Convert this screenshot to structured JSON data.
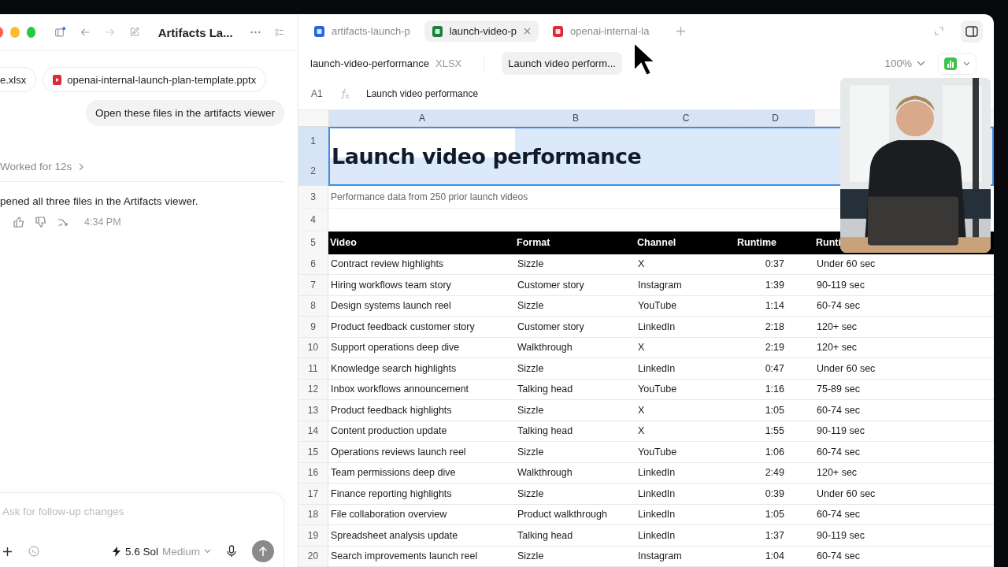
{
  "app_window": {
    "title": "Artifacts La..."
  },
  "chat": {
    "attachments": [
      {
        "name": "e.xlsx"
      },
      {
        "name": "openai-internal-launch-plan-template.pptx",
        "kind": "pptx"
      }
    ],
    "user_message": "Open these files in the artifacts viewer",
    "worked": "Worked for 12s",
    "reply": "pened all three files in the Artifacts viewer.",
    "time": "4:34 PM",
    "composer": {
      "placeholder": "Ask for follow-up changes",
      "model": "5.6 Sol",
      "effort": "Medium"
    }
  },
  "viewer": {
    "tabs": [
      {
        "label": "artifacts-launch-p",
        "kind": "doc",
        "selected": false
      },
      {
        "label": "launch-video-p",
        "kind": "sheet",
        "selected": true
      },
      {
        "label": "openai-internal-la",
        "kind": "slides",
        "selected": false
      }
    ],
    "file_name": "launch-video-performance",
    "file_type": "XLSX",
    "sheet_chip": "Launch video perform...",
    "zoom": "100%"
  },
  "spreadsheet": {
    "cell_ref": "A1",
    "formula": "Launch video performance",
    "columns": [
      "A",
      "B",
      "C",
      "D"
    ],
    "title_rows": [
      "1",
      "2"
    ],
    "title": "Launch video performance",
    "title_selected": true,
    "subtitle_row": "3",
    "subtitle": "Performance data from 250 prior launch videos",
    "blank_row": "4",
    "header_row": "5",
    "headers": [
      "Video",
      "Format",
      "Channel",
      "Runtime",
      "Runti"
    ],
    "rows": [
      {
        "n": "6",
        "cells": [
          "Contract review highlights",
          "Sizzle",
          "X",
          "0:37",
          "Under 60 sec"
        ]
      },
      {
        "n": "7",
        "cells": [
          "Hiring workflows team story",
          "Customer story",
          "Instagram",
          "1:39",
          "90-119 sec"
        ]
      },
      {
        "n": "8",
        "cells": [
          "Design systems launch reel",
          "Sizzle",
          "YouTube",
          "1:14",
          "60-74 sec"
        ]
      },
      {
        "n": "9",
        "cells": [
          "Product feedback customer story",
          "Customer story",
          "LinkedIn",
          "2:18",
          "120+ sec"
        ]
      },
      {
        "n": "10",
        "cells": [
          "Support operations deep dive",
          "Walkthrough",
          "X",
          "2:19",
          "120+ sec"
        ]
      },
      {
        "n": "11",
        "cells": [
          "Knowledge search highlights",
          "Sizzle",
          "LinkedIn",
          "0:47",
          "Under 60 sec"
        ]
      },
      {
        "n": "12",
        "cells": [
          "Inbox workflows announcement",
          "Talking head",
          "YouTube",
          "1:16",
          "75-89 sec"
        ]
      },
      {
        "n": "13",
        "cells": [
          "Product feedback highlights",
          "Sizzle",
          "X",
          "1:05",
          "60-74 sec"
        ]
      },
      {
        "n": "14",
        "cells": [
          "Content production update",
          "Talking head",
          "X",
          "1:55",
          "90-119 sec"
        ]
      },
      {
        "n": "15",
        "cells": [
          "Operations reviews launch reel",
          "Sizzle",
          "YouTube",
          "1:06",
          "60-74 sec"
        ]
      },
      {
        "n": "16",
        "cells": [
          "Team permissions deep dive",
          "Walkthrough",
          "LinkedIn",
          "2:49",
          "120+ sec"
        ]
      },
      {
        "n": "17",
        "cells": [
          "Finance reporting highlights",
          "Sizzle",
          "LinkedIn",
          "0:39",
          "Under 60 sec"
        ]
      },
      {
        "n": "18",
        "cells": [
          "File collaboration overview",
          "Product walkthrough",
          "LinkedIn",
          "1:05",
          "60-74 sec"
        ]
      },
      {
        "n": "19",
        "cells": [
          "Spreadsheet analysis update",
          "Talking head",
          "LinkedIn",
          "1:37",
          "90-119 sec"
        ]
      },
      {
        "n": "20",
        "cells": [
          "Search improvements launch reel",
          "Sizzle",
          "Instagram",
          "1:04",
          "60-74 sec"
        ]
      }
    ]
  }
}
